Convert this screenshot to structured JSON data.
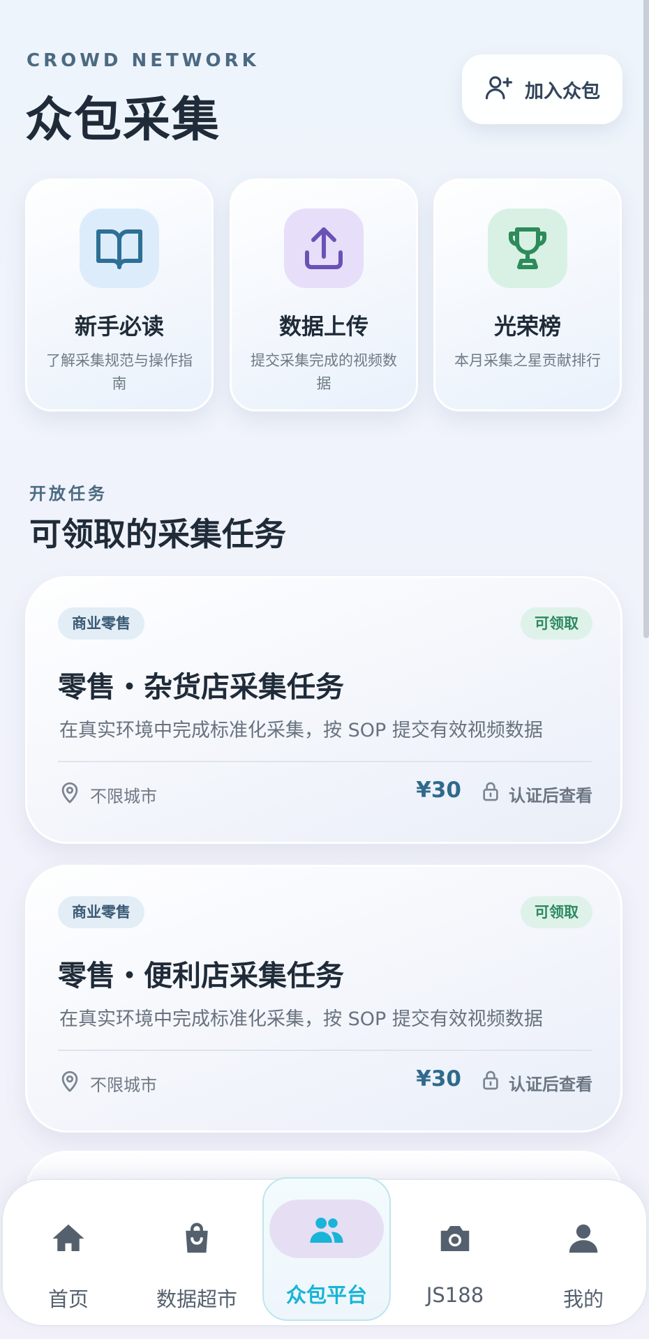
{
  "header": {
    "eyebrow": "CROWD NETWORK",
    "title": "众包采集",
    "join_label": "加入众包"
  },
  "features": [
    {
      "title": "新手必读",
      "desc": "了解采集规范与操作指南",
      "icon": "book-icon",
      "color": "#2d6f95",
      "bg": "#dcecfb"
    },
    {
      "title": "数据上传",
      "desc": "提交采集完成的视频数据",
      "icon": "upload-icon",
      "color": "#6a52b5",
      "bg": "#e7defa"
    },
    {
      "title": "光荣榜",
      "desc": "本月采集之星贡献排行",
      "icon": "trophy-icon",
      "color": "#2e8b5a",
      "bg": "#d8f1e4"
    }
  ],
  "section": {
    "eyebrow": "开放任务",
    "title": "可领取的采集任务"
  },
  "tasks": [
    {
      "tag": "商业零售",
      "status": "可领取",
      "name": "零售・杂货店采集任务",
      "desc": "在真实环境中完成标准化采集，按 SOP 提交有效视频数据",
      "location": "不限城市",
      "price": "¥30",
      "lock_label": "认证后查看"
    },
    {
      "tag": "商业零售",
      "status": "可领取",
      "name": "零售・便利店采集任务",
      "desc": "在真实环境中完成标准化采集，按 SOP 提交有效视频数据",
      "location": "不限城市",
      "price": "¥30",
      "lock_label": "认证后查看"
    }
  ],
  "nav": [
    {
      "label": "首页",
      "icon": "home-icon"
    },
    {
      "label": "数据超市",
      "icon": "shopping-bag-icon"
    },
    {
      "label": "众包平台",
      "icon": "users-icon",
      "active": true
    },
    {
      "label": "JS188",
      "icon": "camera-icon"
    },
    {
      "label": "我的",
      "icon": "user-icon"
    }
  ],
  "colors": {
    "accent": "#19b4d8",
    "price": "#2f6a8c",
    "status_green": "#2c8a5e"
  }
}
